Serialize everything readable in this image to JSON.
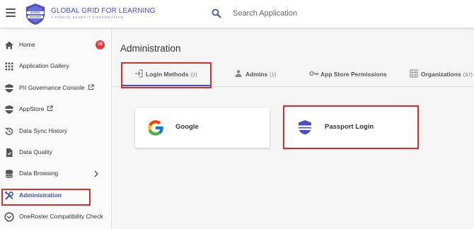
{
  "header": {
    "brand_title": "GLOBAL GRID FOR LEARNING",
    "brand_subtitle": "A PUBLIC BENEFIT CORPORATION",
    "logo_top_text": "SCHOOL",
    "logo_bottom_text": "PASSPORT",
    "search_placeholder": "Search Application"
  },
  "sidebar": {
    "items": [
      {
        "label": "Home",
        "icon": "home-icon",
        "badge": "10"
      },
      {
        "label": "Application Gallery",
        "icon": "apps-grid-icon"
      },
      {
        "label": "PII Governance Console",
        "icon": "shield-icon",
        "external": true
      },
      {
        "label": "AppStore",
        "icon": "shield-icon",
        "external": true
      },
      {
        "label": "Data Sync History",
        "icon": "history-icon"
      },
      {
        "label": "Data Quality",
        "icon": "file-check-icon"
      },
      {
        "label": "Data Browsing",
        "icon": "database-icon",
        "has_submenu": true
      },
      {
        "label": "Administration",
        "icon": "tools-icon",
        "active": true
      },
      {
        "label": "OneRoster Compatibility Check",
        "icon": "oneroster-icon"
      }
    ]
  },
  "main": {
    "title": "Administration",
    "tabs": [
      {
        "label": "Login Methods",
        "count": "(2)",
        "icon": "login-icon",
        "active": true
      },
      {
        "label": "Admins",
        "count": "(1)",
        "icon": "person-icon"
      },
      {
        "label": "App Store Permissions",
        "count": "",
        "icon": "key-icon"
      },
      {
        "label": "Organizations",
        "count": "(37)",
        "icon": "building-icon"
      }
    ],
    "cards": [
      {
        "label": "Google",
        "icon": "google-icon"
      },
      {
        "label": "Passport Login",
        "icon": "passport-icon"
      }
    ]
  },
  "colors": {
    "accent": "#3f51b5",
    "highlight_box": "#d32f2f",
    "badge": "#e53935"
  }
}
